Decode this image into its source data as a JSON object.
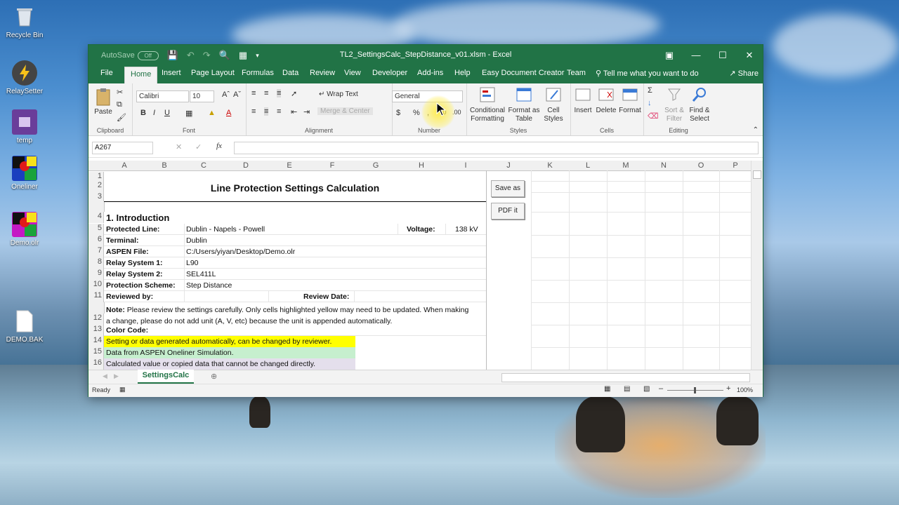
{
  "desktop": {
    "icons": [
      {
        "label": "Recycle Bin",
        "icon": "recycle-bin-icon"
      },
      {
        "label": "RelaySetter",
        "icon": "relaysetter-icon"
      },
      {
        "label": "temp",
        "icon": "folder-icon"
      },
      {
        "label": "Oneliner",
        "icon": "oneliner-icon"
      },
      {
        "label": "Demo.olr",
        "icon": "olr-file-icon"
      },
      {
        "label": "DEMO.BAK",
        "icon": "file-icon"
      }
    ]
  },
  "window": {
    "title": "TL2_SettingsCalc_StepDistance_v01.xlsm  -  Excel",
    "autosave_label": "AutoSave",
    "autosave_state": "Off",
    "accent": "#217346"
  },
  "menu": {
    "tabs": [
      "File",
      "Home",
      "Insert",
      "Page Layout",
      "Formulas",
      "Data",
      "Review",
      "View",
      "Developer",
      "Add-ins",
      "Help",
      "Easy Document Creator",
      "Team"
    ],
    "active": "Home",
    "tell_me": "Tell me what you want to do",
    "share": "Share"
  },
  "ribbon": {
    "clipboard": {
      "label": "Clipboard",
      "paste": "Paste"
    },
    "font": {
      "label": "Font",
      "family": "Calibri",
      "size": "10"
    },
    "alignment": {
      "label": "Alignment",
      "wrap": "Wrap Text",
      "merge": "Merge & Center"
    },
    "number": {
      "label": "Number",
      "format": "General"
    },
    "styles": {
      "label": "Styles",
      "cond1": "Conditional",
      "cond2": "Formatting",
      "fmt1": "Format as",
      "fmt2": "Table",
      "cell1": "Cell",
      "cell2": "Styles"
    },
    "cells": {
      "label": "Cells",
      "insert": "Insert",
      "delete": "Delete",
      "format": "Format"
    },
    "editing": {
      "label": "Editing",
      "sort1": "Sort &",
      "sort2": "Filter",
      "find1": "Find &",
      "find2": "Select"
    }
  },
  "formula_bar": {
    "name_box": "A267",
    "fx": "fx",
    "content": ""
  },
  "columns": [
    "A",
    "B",
    "C",
    "D",
    "E",
    "F",
    "G",
    "H",
    "I",
    "J",
    "K",
    "L",
    "M",
    "N",
    "O",
    "P"
  ],
  "rows": [
    "1",
    "2",
    "3",
    "4",
    "5",
    "6",
    "7",
    "8",
    "9",
    "10",
    "11",
    "12",
    "13",
    "14",
    "15",
    "16"
  ],
  "sheet": {
    "title": "Line Protection Settings Calculation",
    "section": "1. Introduction",
    "protected_line_label": "Protected Line:",
    "protected_line": "Dublin - Napels - Powell",
    "voltage_label": "Voltage:",
    "voltage": "138 kV",
    "terminal_label": "Terminal:",
    "terminal": "Dublin",
    "aspen_label": "ASPEN File:",
    "aspen": "C:/Users/yiyan/Desktop/Demo.olr",
    "relay1_label": "Relay System 1:",
    "relay1": "L90",
    "relay2_label": "Relay System 2:",
    "relay2": "SEL411L",
    "scheme_label": "Protection Scheme:",
    "scheme": "Step Distance",
    "reviewed_label": "Reviewed by:",
    "review_date_label": "Review Date:",
    "note_bold": "Note:",
    "note_line1": " Please review the settings carefully. Only cells highlighted yellow may need to be updated. When making",
    "note_line2": "a change, please do not add unit (A, V, etc) because the unit is appended automatically.",
    "color_code_label": "Color Code:",
    "legend_yellow": "Setting or data generated automatically, can be changed by reviewer.",
    "legend_green": "Data from ASPEN Oneliner Simulation.",
    "legend_purple": "Calculated value or copied data that cannot be changed directly.",
    "color_yellow": "#ffff00",
    "color_green": "#c6efce",
    "color_purple": "#e4dfec"
  },
  "buttons": {
    "save_as": "Save as",
    "pdf": "PDF it"
  },
  "sheet_tab": "SettingsCalc",
  "status": {
    "ready": "Ready",
    "zoom": "100%"
  }
}
